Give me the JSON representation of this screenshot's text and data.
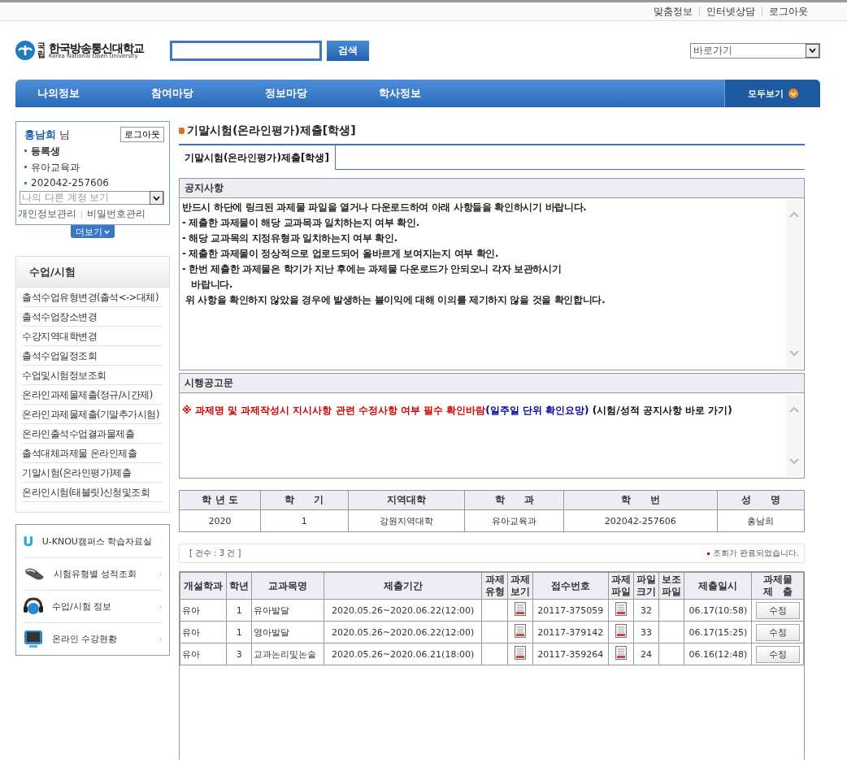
{
  "top_links": [
    "맞춤정보",
    "인터넷상담",
    "로그아웃"
  ],
  "logo": {
    "small": "국립",
    "name": "한국방송통신대학교",
    "english": "Korea National Open University"
  },
  "search": {
    "button": "검색"
  },
  "shortcut_select": {
    "value": "바로가기"
  },
  "nav": {
    "items": [
      "나의정보",
      "참여마당",
      "정보마당",
      "학사정보"
    ],
    "all_button": "모두보기"
  },
  "user": {
    "name": "홍남희",
    "suffix": "님",
    "logout": "로그아웃",
    "status": "등록생",
    "department": "유아교육과",
    "student_id": "202042-257606",
    "account_select": "나의 다른 계정 보기",
    "links": [
      "개인정보관리",
      "비밀번호관리"
    ],
    "more": "더보기"
  },
  "menu": {
    "title": "수업/시험",
    "items": [
      {
        "label": "출석수업유형변경(출석<->대체)",
        "selected": false
      },
      {
        "label": "출석수업장소변경",
        "selected": false
      },
      {
        "label": "수강지역대학변경",
        "selected": false
      },
      {
        "label": "출석수업일정조회",
        "selected": false
      },
      {
        "label": "수업및시험정보조회",
        "selected": false
      },
      {
        "label": "온라인과제물제출(정규/시간제)",
        "selected": false
      },
      {
        "label": "온라인과제물제출(기말추가시험)",
        "selected": false
      },
      {
        "label": "온라인출석수업결과물제출",
        "selected": false
      },
      {
        "label": "출석대체과제물 온라인제출",
        "selected": false
      },
      {
        "label": "기말시험(온라인평가)제출",
        "selected": false
      },
      {
        "label": "온라인시험(태블릿)신청및조회",
        "selected": false
      }
    ]
  },
  "quick_links": [
    {
      "kind": "u",
      "label": "U-KNOU캠퍼스 학습자료실"
    },
    {
      "kind": "mouse",
      "label": "시험유형별 성적조회"
    },
    {
      "kind": "headset",
      "label": "수업/시험 정보"
    },
    {
      "kind": "monitor",
      "label": "온라인 수강현황"
    }
  ],
  "page_title": "기말시험(온라인평가)제출[학생]",
  "tabs": [
    {
      "label": "기말시험(온라인평가)제출[학생]",
      "selected": true
    }
  ],
  "notice": {
    "title": "공지사항",
    "lines": [
      "반드시 하단에 링크된 과제물 파일을 열거나 다운로드하여 아래 사항들을 확인하시기 바랍니다.",
      "- 제출한 과제물이 해당 교과목과 일치하는지 여부 확인.",
      "- 해당 교과목의 지정유형과 일치하는지 여부 확인.",
      "- 제출한 과제물이 정상적으로 업로드되어 올바르게 보여지는지 여부 확인.",
      "- 한번 제출한 과제물은 학기가 지난 후에는 과제물 다운로드가 안되오니 각자 보관하시기",
      "   바랍니다.",
      " 위 사항을 확인하지 않았을 경우에 발생하는 불이익에 대해 이의를 제기하지 않을 것을 확인합니다."
    ]
  },
  "exam_notice": {
    "title": "시행공고문",
    "segments": [
      {
        "text": "※ 과제명 및 과제작성시 지시사항 관련 수정사항 여부 필수 확인바람",
        "color": "#d00000"
      },
      {
        "text": "(일주일 단위 확인요망)",
        "color": "#0000a0"
      },
      {
        "text": " (시험/성적 공지사항 바로 가기)",
        "color": "#111111"
      }
    ]
  },
  "info_table": {
    "columns": [
      "학 년 도",
      "학　　기",
      "지역대학",
      "학　　과",
      "학　　번",
      "성　　명"
    ],
    "row": [
      "2020",
      "1",
      "강원지역대학",
      "유아교육과",
      "202042-257606",
      "홍남희"
    ]
  },
  "count": {
    "text": "[ 건수 : 3 건 ]",
    "status": "조회가 완료되었습니다."
  },
  "submissions": {
    "columns": [
      "개설학과",
      "학년",
      "교과목명",
      "제출기간",
      "과제\n유형",
      "과제\n보기",
      "접수번호",
      "과제\n파일",
      "파일\n크기",
      "보조\n파일",
      "제출일시",
      "과제물\n제　출"
    ],
    "rows": [
      {
        "dept": "유아",
        "year": "1",
        "course": "유아발달",
        "period": "2020.05.26~2020.06.22(12:00)",
        "view_file": true,
        "receipt": "20117-375059",
        "task_file": true,
        "size": "32",
        "submitted": "06.17(10:58)",
        "action": "수정"
      },
      {
        "dept": "유아",
        "year": "1",
        "course": "영아발달",
        "period": "2020.05.26~2020.06.22(12:00)",
        "view_file": true,
        "receipt": "20117-379142",
        "task_file": true,
        "size": "33",
        "submitted": "06.17(15:25)",
        "action": "수정"
      },
      {
        "dept": "유아",
        "year": "3",
        "course": "교과논리및논술",
        "period": "2020.05.26~2020.06.21(18:00)",
        "view_file": true,
        "receipt": "20117-359264",
        "task_file": true,
        "size": "24",
        "submitted": "06.16(12:48)",
        "action": "수정"
      }
    ]
  }
}
